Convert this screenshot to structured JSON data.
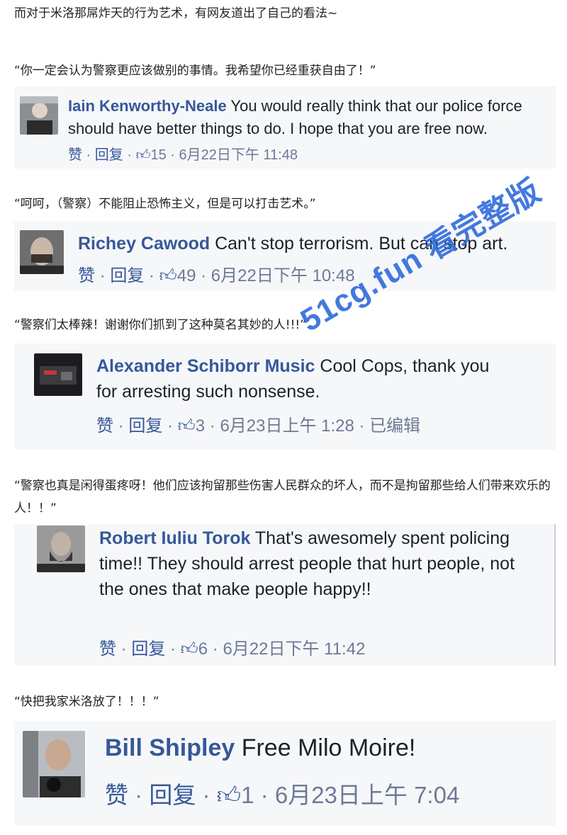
{
  "intro": "而对于米洛那屌炸天的行为艺术，有网友道出了自己的看法~",
  "comments": [
    {
      "quote": "“你一定会认为警察更应该做别的事情。我希望你已经重获自由了！”",
      "name": "Iain Kenworthy-Neale",
      "text": " You would really think that our police force should have better things to do. I hope that you are free now.",
      "like": "赞",
      "reply": "回复",
      "likes": "15",
      "time": "6月22日下午 11:48",
      "edited": ""
    },
    {
      "quote": "“呵呵，（警察）不能阻止恐怖主义，但是可以打击艺术。”",
      "name": "Richey Cawood",
      "text": " Can't stop terrorism. But can stop art.",
      "like": "赞",
      "reply": "回复",
      "likes": "49",
      "time": "6月22日下午 10:48",
      "edited": ""
    },
    {
      "quote": "“警察们太棒辣！谢谢你们抓到了这种莫名其妙的人!!!”",
      "name": "Alexander Schiborr Music",
      "text": " Cool Cops, thank you for arresting such nonsense.",
      "like": "赞",
      "reply": "回复",
      "likes": "3",
      "time": "6月23日上午 1:28",
      "edited": "已编辑"
    },
    {
      "quote": "“警察也真是闲得蛋疼呀！他们应该拘留那些伤害人民群众的坏人，而不是拘留那些给人们带来欢乐的人！！”",
      "name": "Robert Iuliu Torok",
      "text": " That's awesomely spent policing time!! They should arrest people that hurt people, not the ones that make people happy!!",
      "like": "赞",
      "reply": "回复",
      "likes": "6",
      "time": "6月22日下午 11:42",
      "edited": ""
    },
    {
      "quote": "“快把我家米洛放了！！！”",
      "name": "Bill Shipley",
      "text": " Free Milo Moire!",
      "like": "赞",
      "reply": "回复",
      "likes": "1",
      "time": "6月23日上午 7:04",
      "edited": ""
    }
  ],
  "watermark": "51cg.fun 看完整版",
  "icons": {
    "like": "thumbs-up-icon"
  },
  "colors": {
    "name": "#365899",
    "meta": "#6d7a96",
    "card": "#f6f7f9",
    "watermark": "#2f6bdc"
  }
}
